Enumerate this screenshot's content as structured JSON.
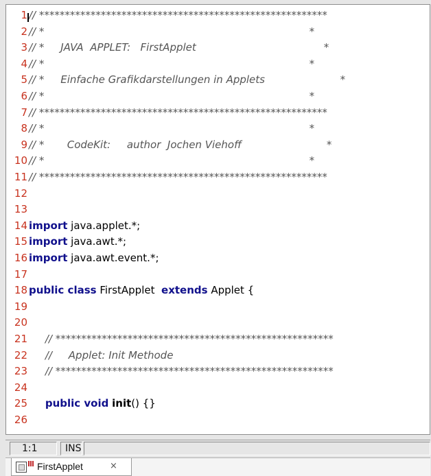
{
  "editor": {
    "lines": [
      {
        "n": "1",
        "segments": [
          {
            "t": "cm",
            "v": "// ********************************************************"
          }
        ]
      },
      {
        "n": "2",
        "segments": [
          {
            "t": "cm",
            "v": "// *                                                                                 *"
          }
        ]
      },
      {
        "n": "3",
        "segments": [
          {
            "t": "cm",
            "v": "// *     JAVA  APPLET:   FirstApplet                                       *"
          }
        ]
      },
      {
        "n": "4",
        "segments": [
          {
            "t": "cm",
            "v": "// *                                                                                 *"
          }
        ]
      },
      {
        "n": "5",
        "segments": [
          {
            "t": "cm",
            "v": "// *     Einfache Grafikdarstellungen in Applets                       *"
          }
        ]
      },
      {
        "n": "6",
        "segments": [
          {
            "t": "cm",
            "v": "// *                                                                                 *"
          }
        ]
      },
      {
        "n": "7",
        "segments": [
          {
            "t": "cm",
            "v": "// ********************************************************"
          }
        ]
      },
      {
        "n": "8",
        "segments": [
          {
            "t": "cm",
            "v": "// *                                                                                 *"
          }
        ]
      },
      {
        "n": "9",
        "segments": [
          {
            "t": "cm",
            "v": "// *       CodeKit:     author  Jochen Viehoff                          *"
          }
        ]
      },
      {
        "n": "10",
        "segments": [
          {
            "t": "cm",
            "v": "// *                                                                                 *"
          }
        ]
      },
      {
        "n": "11",
        "segments": [
          {
            "t": "cm",
            "v": "// ********************************************************"
          }
        ]
      },
      {
        "n": "12",
        "segments": []
      },
      {
        "n": "13",
        "segments": []
      },
      {
        "n": "14",
        "segments": [
          {
            "t": "kw",
            "v": "import"
          },
          {
            "t": "tx",
            "v": " java.applet.*;"
          }
        ]
      },
      {
        "n": "15",
        "segments": [
          {
            "t": "kw",
            "v": "import"
          },
          {
            "t": "tx",
            "v": " java.awt.*;"
          }
        ]
      },
      {
        "n": "16",
        "segments": [
          {
            "t": "kw",
            "v": "import"
          },
          {
            "t": "tx",
            "v": " java.awt.event.*;"
          }
        ]
      },
      {
        "n": "17",
        "segments": []
      },
      {
        "n": "18",
        "segments": [
          {
            "t": "kw",
            "v": "public class"
          },
          {
            "t": "tx",
            "v": " FirstApplet  "
          },
          {
            "t": "kw",
            "v": "extends"
          },
          {
            "t": "tx",
            "v": " Applet {"
          }
        ]
      },
      {
        "n": "19",
        "segments": []
      },
      {
        "n": "20",
        "segments": []
      },
      {
        "n": "21",
        "segments": [
          {
            "t": "tx",
            "v": "     "
          },
          {
            "t": "cm",
            "v": "// ******************************************************"
          }
        ]
      },
      {
        "n": "22",
        "segments": [
          {
            "t": "tx",
            "v": "     "
          },
          {
            "t": "cm",
            "v": "//     Applet: Init Methode"
          }
        ]
      },
      {
        "n": "23",
        "segments": [
          {
            "t": "tx",
            "v": "     "
          },
          {
            "t": "cm",
            "v": "// ******************************************************"
          }
        ]
      },
      {
        "n": "24",
        "segments": []
      },
      {
        "n": "25",
        "segments": [
          {
            "t": "tx",
            "v": "     "
          },
          {
            "t": "kw",
            "v": "public void"
          },
          {
            "t": "tx",
            "v": " "
          },
          {
            "t": "fn",
            "v": "init"
          },
          {
            "t": "tx",
            "v": "() {}"
          }
        ]
      },
      {
        "n": "26",
        "segments": []
      }
    ]
  },
  "statusbar": {
    "position": "1:1",
    "mode": "INS"
  },
  "tabs": [
    {
      "label": "FirstApplet",
      "close": "×",
      "icon": "applet-file-icon"
    }
  ]
}
